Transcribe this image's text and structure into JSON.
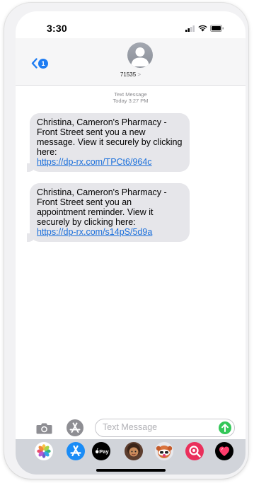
{
  "status_bar": {
    "time": "3:30"
  },
  "header": {
    "back_badge_count": "1",
    "contact_name": "71535",
    "contact_chevron": ">"
  },
  "timestamp": {
    "label": "Text Message",
    "time": "Today 3:27 PM"
  },
  "messages": [
    {
      "text": "Christina, Cameron's Pharmacy - Front Street sent you a new message. View it securely by clicking here:",
      "link": "https://dp-rx.com/TPCt6/964c"
    },
    {
      "text": "Christina, Cameron's Pharmacy - Front Street sent you an appointment reminder. View it securely by clicking here:",
      "link": "https://dp-rx.com/s14pS/5d9a"
    }
  ],
  "compose": {
    "placeholder": "Text Message"
  },
  "app_drawer": {
    "items": [
      {
        "icon": "photos-icon"
      },
      {
        "icon": "app-store-icon"
      },
      {
        "icon": "apple-pay-icon",
        "label": "Pay"
      },
      {
        "icon": "memoji-icon"
      },
      {
        "icon": "animoji-icon"
      },
      {
        "icon": "image-search-icon"
      },
      {
        "icon": "digital-touch-icon"
      }
    ]
  },
  "colors": {
    "accent": "#1e7cf2",
    "bubble": "#e6e6ea",
    "link": "#1a6fdb",
    "send": "#34c759"
  }
}
